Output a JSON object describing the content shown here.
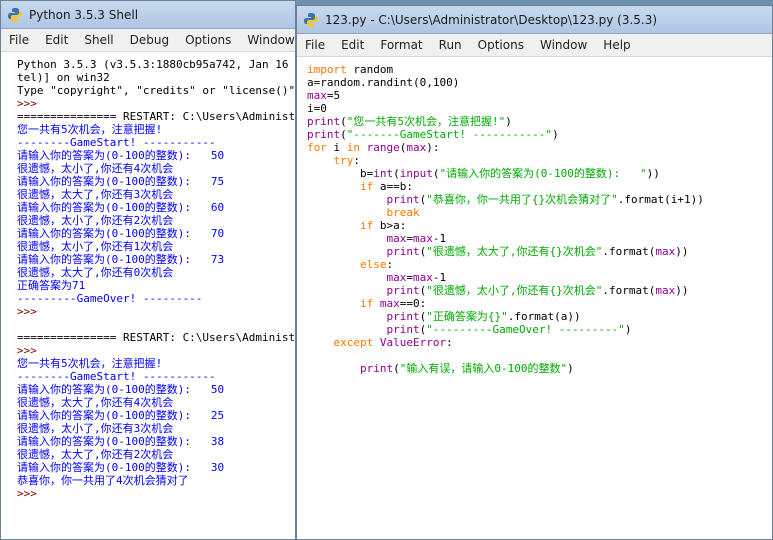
{
  "shell": {
    "title": "Python 3.5.3 Shell",
    "menu": [
      "File",
      "Edit",
      "Shell",
      "Debug",
      "Options",
      "Window"
    ],
    "lines": [
      {
        "text": "Python 3.5.3 (v3.5.3:1880cb95a742, Jan 16 2017",
        "c": "t"
      },
      {
        "text": "tel)] on win32",
        "c": "t"
      },
      {
        "text": "Type \"copyright\", \"credits\" or \"license()\"",
        "c": "t"
      },
      {
        "text": ">>>",
        "c": "p"
      },
      {
        "text": "=============== RESTART: C:\\Users\\Administrator",
        "c": "t"
      },
      {
        "text": "您一共有5次机会，注意把握!",
        "c": "o"
      },
      {
        "text": "--------GameStart! -----------",
        "c": "o"
      },
      {
        "text": "请输入你的答案为(0-100的整数):   50",
        "c": "o"
      },
      {
        "text": "很遗憾，太小了,你还有4次机会",
        "c": "o"
      },
      {
        "text": "请输入你的答案为(0-100的整数):   75",
        "c": "o"
      },
      {
        "text": "很遗憾，太大了,你还有3次机会",
        "c": "o"
      },
      {
        "text": "请输入你的答案为(0-100的整数):   60",
        "c": "o"
      },
      {
        "text": "很遗憾，太小了,你还有2次机会",
        "c": "o"
      },
      {
        "text": "请输入你的答案为(0-100的整数):   70",
        "c": "o"
      },
      {
        "text": "很遗憾，太小了,你还有1次机会",
        "c": "o"
      },
      {
        "text": "请输入你的答案为(0-100的整数):   73",
        "c": "o"
      },
      {
        "text": "很遗憾，太大了,你还有0次机会",
        "c": "o"
      },
      {
        "text": "正确答案为71",
        "c": "o"
      },
      {
        "text": "---------GameOver! ---------",
        "c": "o"
      },
      {
        "text": ">>>",
        "c": "p"
      },
      {
        "text": "",
        "c": "t"
      },
      {
        "text": "=============== RESTART: C:\\Users\\Administrator",
        "c": "t"
      },
      {
        "text": ">>>",
        "c": "p"
      },
      {
        "text": "您一共有5次机会，注意把握!",
        "c": "o"
      },
      {
        "text": "--------GameStart! -----------",
        "c": "o"
      },
      {
        "text": "请输入你的答案为(0-100的整数):   50",
        "c": "o"
      },
      {
        "text": "很遗憾，太大了,你还有4次机会",
        "c": "o"
      },
      {
        "text": "请输入你的答案为(0-100的整数):   25",
        "c": "o"
      },
      {
        "text": "很遗憾，太小了,你还有3次机会",
        "c": "o"
      },
      {
        "text": "请输入你的答案为(0-100的整数):   38",
        "c": "o"
      },
      {
        "text": "很遗憾，太大了,你还有2次机会",
        "c": "o"
      },
      {
        "text": "请输入你的答案为(0-100的整数):   30",
        "c": "o"
      },
      {
        "text": "恭喜你，你一共用了4次机会猜对了",
        "c": "o"
      },
      {
        "text": ">>>",
        "c": "p"
      }
    ]
  },
  "editor": {
    "title": "123.py - C:\\Users\\Administrator\\Desktop\\123.py (3.5.3)",
    "menu": [
      "File",
      "Edit",
      "Format",
      "Run",
      "Options",
      "Window",
      "Help"
    ],
    "lines": [
      [
        {
          "t": "import",
          "c": "k"
        },
        {
          "t": " random",
          "c": "t"
        }
      ],
      [
        {
          "t": "a=random.randint(0,100)",
          "c": "t"
        }
      ],
      [
        {
          "t": "max",
          "c": "b"
        },
        {
          "t": "=5",
          "c": "t"
        }
      ],
      [
        {
          "t": "i=0",
          "c": "t"
        }
      ],
      [
        {
          "t": "print",
          "c": "b"
        },
        {
          "t": "(",
          "c": "t"
        },
        {
          "t": "\"您一共有5次机会，注意把握!\"",
          "c": "s"
        },
        {
          "t": ")",
          "c": "t"
        }
      ],
      [
        {
          "t": "print",
          "c": "b"
        },
        {
          "t": "(",
          "c": "t"
        },
        {
          "t": "\"-------GameStart! -----------\"",
          "c": "s"
        },
        {
          "t": ")",
          "c": "t"
        }
      ],
      [
        {
          "t": "for",
          "c": "k"
        },
        {
          "t": " i ",
          "c": "t"
        },
        {
          "t": "in",
          "c": "k"
        },
        {
          "t": " ",
          "c": "t"
        },
        {
          "t": "range",
          "c": "b"
        },
        {
          "t": "(",
          "c": "t"
        },
        {
          "t": "max",
          "c": "b"
        },
        {
          "t": "):",
          "c": "t"
        }
      ],
      [
        {
          "t": "    ",
          "c": "t"
        },
        {
          "t": "try",
          "c": "k"
        },
        {
          "t": ":",
          "c": "t"
        }
      ],
      [
        {
          "t": "        b=",
          "c": "t"
        },
        {
          "t": "int",
          "c": "b"
        },
        {
          "t": "(",
          "c": "t"
        },
        {
          "t": "input",
          "c": "b"
        },
        {
          "t": "(",
          "c": "t"
        },
        {
          "t": "\"请输入你的答案为(0-100的整数):   \"",
          "c": "s"
        },
        {
          "t": "))",
          "c": "t"
        }
      ],
      [
        {
          "t": "        ",
          "c": "t"
        },
        {
          "t": "if",
          "c": "k"
        },
        {
          "t": " a==b:",
          "c": "t"
        }
      ],
      [
        {
          "t": "            ",
          "c": "t"
        },
        {
          "t": "print",
          "c": "b"
        },
        {
          "t": "(",
          "c": "t"
        },
        {
          "t": "\"恭喜你，你一共用了{}次机会猜对了\"",
          "c": "s"
        },
        {
          "t": ".format(i+1))",
          "c": "t"
        }
      ],
      [
        {
          "t": "            ",
          "c": "t"
        },
        {
          "t": "break",
          "c": "k"
        }
      ],
      [
        {
          "t": "        ",
          "c": "t"
        },
        {
          "t": "if",
          "c": "k"
        },
        {
          "t": " b>a:",
          "c": "t"
        }
      ],
      [
        {
          "t": "            ",
          "c": "t"
        },
        {
          "t": "max",
          "c": "b"
        },
        {
          "t": "=",
          "c": "t"
        },
        {
          "t": "max",
          "c": "b"
        },
        {
          "t": "-1",
          "c": "t"
        }
      ],
      [
        {
          "t": "            ",
          "c": "t"
        },
        {
          "t": "print",
          "c": "b"
        },
        {
          "t": "(",
          "c": "t"
        },
        {
          "t": "\"很遗憾，太大了,你还有{}次机会\"",
          "c": "s"
        },
        {
          "t": ".format(",
          "c": "t"
        },
        {
          "t": "max",
          "c": "b"
        },
        {
          "t": "))",
          "c": "t"
        }
      ],
      [
        {
          "t": "        ",
          "c": "t"
        },
        {
          "t": "else",
          "c": "k"
        },
        {
          "t": ":",
          "c": "t"
        }
      ],
      [
        {
          "t": "            ",
          "c": "t"
        },
        {
          "t": "max",
          "c": "b"
        },
        {
          "t": "=",
          "c": "t"
        },
        {
          "t": "max",
          "c": "b"
        },
        {
          "t": "-1",
          "c": "t"
        }
      ],
      [
        {
          "t": "            ",
          "c": "t"
        },
        {
          "t": "print",
          "c": "b"
        },
        {
          "t": "(",
          "c": "t"
        },
        {
          "t": "\"很遗憾，太小了,你还有{}次机会\"",
          "c": "s"
        },
        {
          "t": ".format(",
          "c": "t"
        },
        {
          "t": "max",
          "c": "b"
        },
        {
          "t": "))",
          "c": "t"
        }
      ],
      [
        {
          "t": "        ",
          "c": "t"
        },
        {
          "t": "if",
          "c": "k"
        },
        {
          "t": " ",
          "c": "t"
        },
        {
          "t": "max",
          "c": "b"
        },
        {
          "t": "==0:",
          "c": "t"
        }
      ],
      [
        {
          "t": "            ",
          "c": "t"
        },
        {
          "t": "print",
          "c": "b"
        },
        {
          "t": "(",
          "c": "t"
        },
        {
          "t": "\"正确答案为{}\"",
          "c": "s"
        },
        {
          "t": ".format(a))",
          "c": "t"
        }
      ],
      [
        {
          "t": "            ",
          "c": "t"
        },
        {
          "t": "print",
          "c": "b"
        },
        {
          "t": "(",
          "c": "t"
        },
        {
          "t": "\"---------GameOver! ---------\"",
          "c": "s"
        },
        {
          "t": ")",
          "c": "t"
        }
      ],
      [
        {
          "t": "    ",
          "c": "t"
        },
        {
          "t": "except",
          "c": "k"
        },
        {
          "t": " ",
          "c": "t"
        },
        {
          "t": "ValueError",
          "c": "b"
        },
        {
          "t": ":",
          "c": "t"
        }
      ],
      [
        {
          "t": "",
          "c": "t"
        }
      ],
      [
        {
          "t": "        ",
          "c": "t"
        },
        {
          "t": "print",
          "c": "b"
        },
        {
          "t": "(",
          "c": "t"
        },
        {
          "t": "\"输入有误，请输入0-100的整数\"",
          "c": "s"
        },
        {
          "t": ")",
          "c": "t"
        }
      ]
    ]
  },
  "colors": {
    "keyword": "#ff7700",
    "builtin": "#900090",
    "string": "#00aa00",
    "output": "#0000ff",
    "prompt": "#7f0000"
  },
  "icons": {
    "window": "python-icon"
  }
}
